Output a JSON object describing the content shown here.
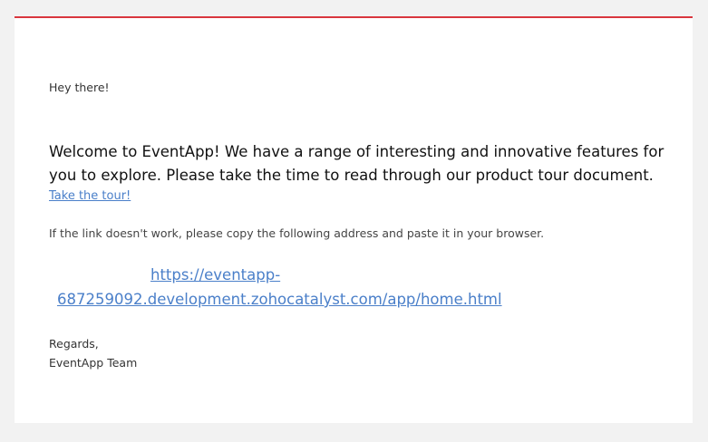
{
  "email": {
    "greeting": "Hey there!",
    "welcome_text": "Welcome to EventApp! We have a range of  interesting and innovative features for you to explore. Please take the time to read through our product tour document.",
    "tour_link_label": "Take the tour!",
    "instruction_text": "If the link doesn't work, please copy the following address and paste it in your browser.",
    "address_url": "https://eventapp-687259092.development.zohocatalyst.com/app/home.html",
    "regards": "Regards,",
    "signature": "EventApp Team"
  },
  "colors": {
    "accent_border": "#d9363e",
    "link": "#4a7fc9",
    "background": "#f2f2f2",
    "card": "#ffffff"
  }
}
